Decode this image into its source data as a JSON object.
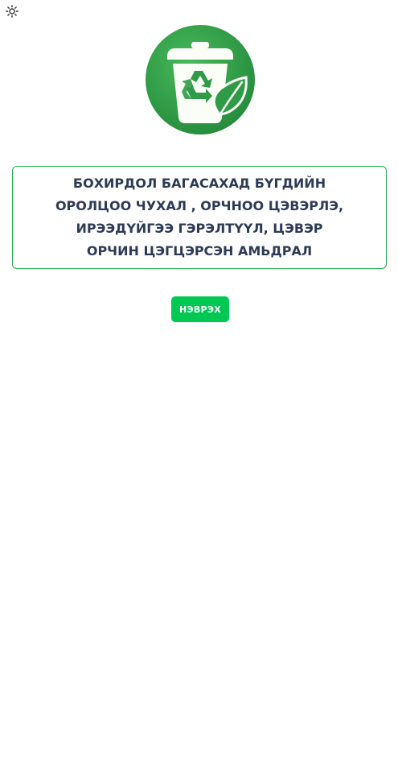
{
  "header": {
    "theme_toggle_icon": "sun-icon"
  },
  "logo": {
    "icon": "recycle-bin-leaf-icon",
    "colors": {
      "circle": "#2e9f45",
      "bin": "#fbfdf7",
      "recycle_arrows": "#2f9b47",
      "leaf": "#2f9b47"
    }
  },
  "slogan": {
    "lines": [
      "БОХИРДОЛ БАГАСАХАД БҮГДИЙН",
      "ОРОЛЦОО ЧУХАЛ , ОРЧНОО ЦЭВЭРЛЭ,",
      "ИРЭЭДҮЙГЭЭ ГЭРЭЛТҮҮЛ, ЦЭВЭР",
      "ОРЧИН ЦЭГЦЭРСЭН АМЬДРАЛ"
    ],
    "border_color": "#22b04c",
    "text_color": "#2d3b56"
  },
  "actions": {
    "login_label": "НЭВРЭХ",
    "login_color": "#00c853"
  }
}
